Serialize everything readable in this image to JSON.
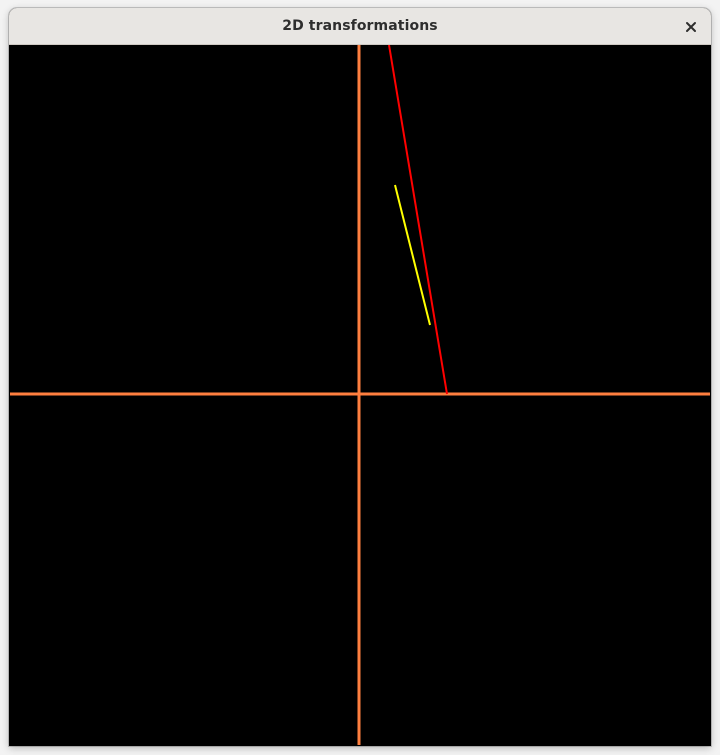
{
  "window": {
    "title": "2D transformations",
    "close_icon": "close-icon"
  },
  "colors": {
    "background": "#000000",
    "axes": "#ff7f3f",
    "original_line": "#ff0000",
    "transformed_line": "#ffff00",
    "titlebar": "#e8e6e3"
  }
}
